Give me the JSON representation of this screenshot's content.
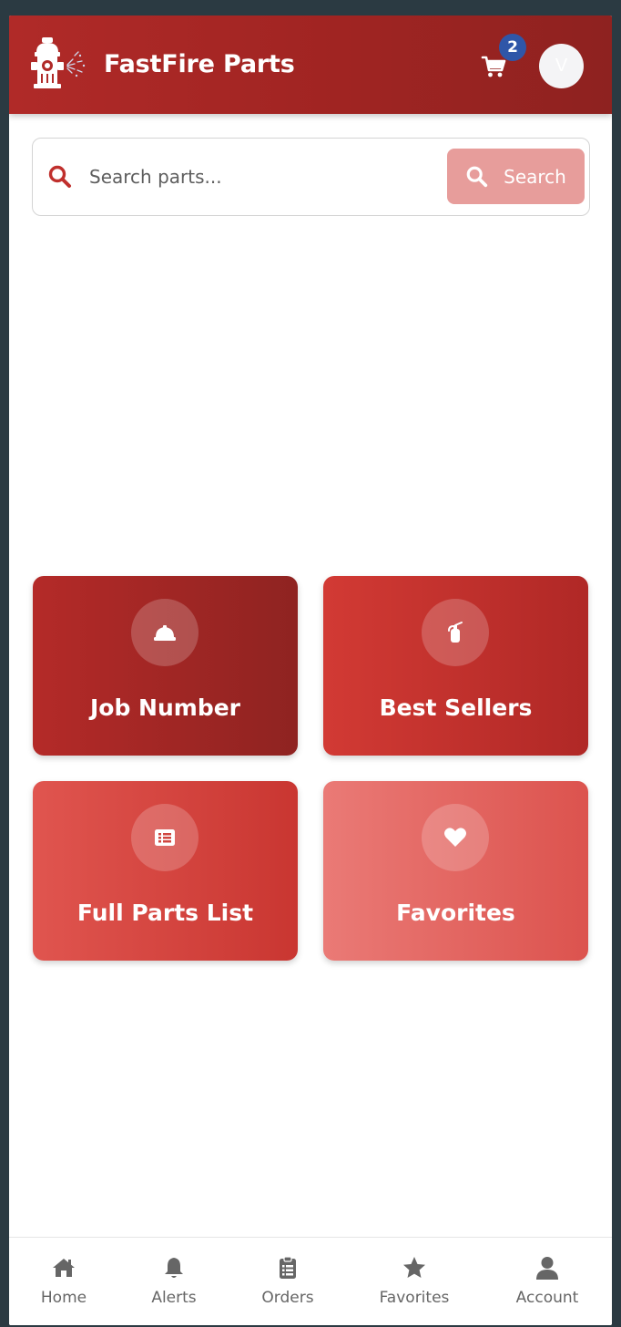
{
  "header": {
    "title": "FastFire Parts",
    "cart_count": "2",
    "avatar_initial": "V",
    "brand_color": "#a02422"
  },
  "search": {
    "placeholder": "Search parts...",
    "button_label": "Search"
  },
  "tiles": [
    {
      "label": "Job Number",
      "icon": "hard-hat-icon"
    },
    {
      "label": "Best Sellers",
      "icon": "fire-extinguisher-icon"
    },
    {
      "label": "Full Parts List",
      "icon": "list-icon"
    },
    {
      "label": "Favorites",
      "icon": "heart-icon"
    }
  ],
  "nav": [
    {
      "label": "Home",
      "icon": "home-icon"
    },
    {
      "label": "Alerts",
      "icon": "bell-icon"
    },
    {
      "label": "Orders",
      "icon": "clipboard-list-icon"
    },
    {
      "label": "Favorites",
      "icon": "star-icon"
    },
    {
      "label": "Account",
      "icon": "user-icon"
    }
  ]
}
